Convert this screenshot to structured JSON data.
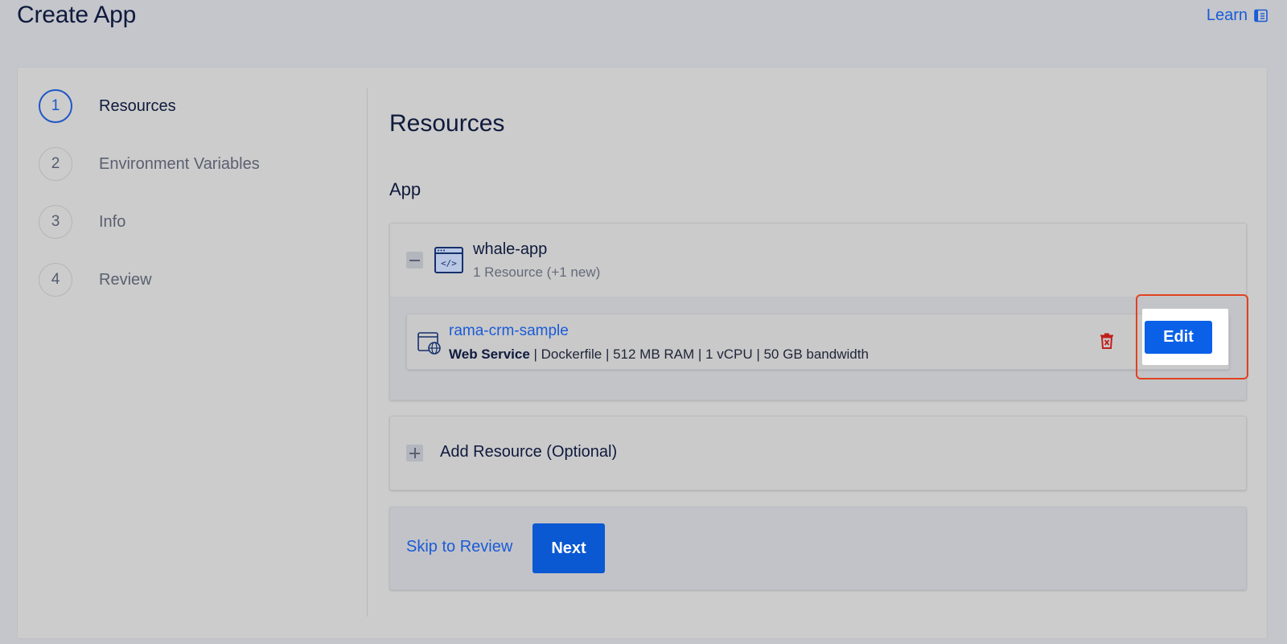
{
  "header": {
    "title": "Create App",
    "learn_label": "Learn"
  },
  "stepper": {
    "steps": [
      {
        "number": "1",
        "label": "Resources",
        "active": true
      },
      {
        "number": "2",
        "label": "Environment Variables",
        "active": false
      },
      {
        "number": "3",
        "label": "Info",
        "active": false
      },
      {
        "number": "4",
        "label": "Review",
        "active": false
      }
    ]
  },
  "main": {
    "section_title": "Resources",
    "subsection_title": "App",
    "app": {
      "name": "whale-app",
      "resource_count": "1 Resource (+1 new)",
      "resource": {
        "name": "rama-crm-sample",
        "type": "Web Service",
        "details": " | Dockerfile | 512 MB RAM | 1 vCPU | 50 GB bandwidth",
        "edit_label": "Edit"
      }
    },
    "add_resource_label": "Add Resource (Optional)",
    "footer": {
      "skip_label": "Skip to Review",
      "next_label": "Next"
    }
  },
  "colors": {
    "accent": "#0a61e8",
    "highlight": "#e0421f",
    "delete": "#c0201a"
  }
}
